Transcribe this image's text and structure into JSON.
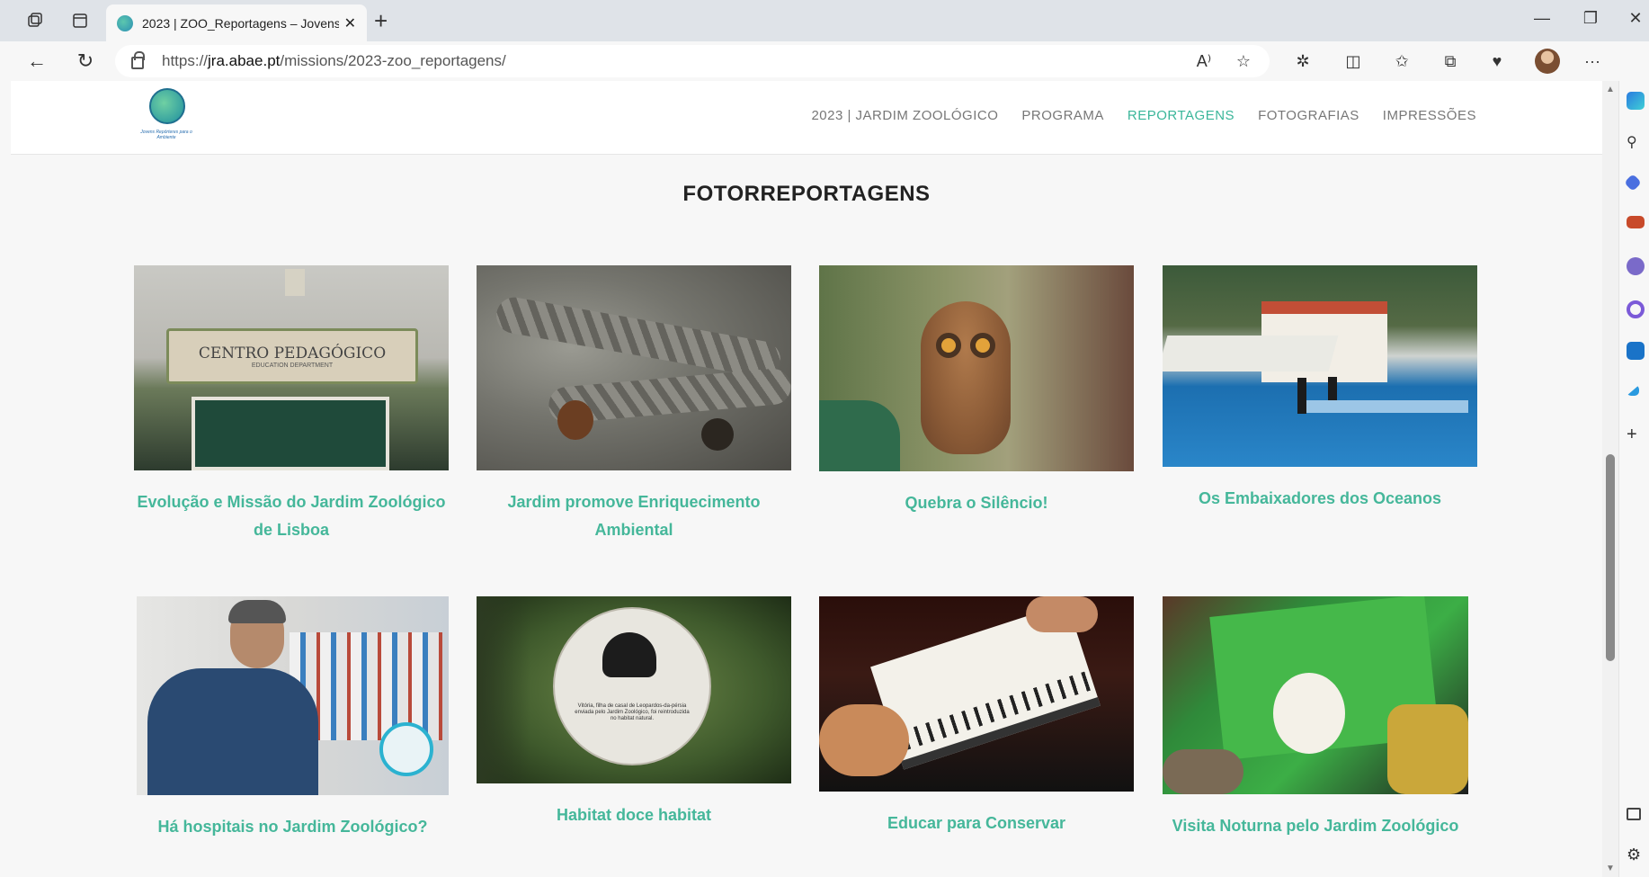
{
  "browser": {
    "tab_title": "2023 | ZOO_Reportagens – Jovens",
    "url_prefix": "https://",
    "url_domain": "jra.abae.pt",
    "url_path": "/missions/2023-zoo_reportagens/"
  },
  "site": {
    "logo_text": "Jovens Repórteres para o Ambiente",
    "nav": [
      "2023 | JARDIM ZOOLÓGICO",
      "PROGRAMA",
      "REPORTAGENS",
      "FOTOGRAFIAS",
      "IMPRESSÕES"
    ],
    "active_nav": "REPORTAGENS"
  },
  "section": {
    "title": "FOTORREPORTAGENS"
  },
  "cards": [
    {
      "caption": "Evolução e Missão do Jardim Zoológico de Lisboa",
      "image": "centro-pedagogico-photo",
      "sign_text": "CENTRO PEDAGÓGICO",
      "sign_sub": "EDUCATION DEPARTMENT"
    },
    {
      "caption": "Jardim promove Enriquecimento Ambiental",
      "image": "rope-pinecones-photo"
    },
    {
      "caption": "Quebra o Silêncio!",
      "image": "owl-photo"
    },
    {
      "caption": "Os Embaixadores dos Oceanos",
      "image": "dolphin-pool-photo"
    },
    {
      "caption": "Há hospitais no Jardim Zoológico?",
      "image": "veterinarian-interview-photo"
    },
    {
      "caption": "Habitat doce habitat",
      "image": "leopard-sign-photo",
      "sign_text": "Vitória, filha de casal de Leopardos-da-pérsia enviada pelo Jardim Zoológico, foi reintroduzida no habitat natural."
    },
    {
      "caption": "Educar para Conservar",
      "image": "notebook-photo"
    },
    {
      "caption": "Visita Noturna pelo Jardim Zoológico",
      "image": "green-paper-photo"
    }
  ]
}
